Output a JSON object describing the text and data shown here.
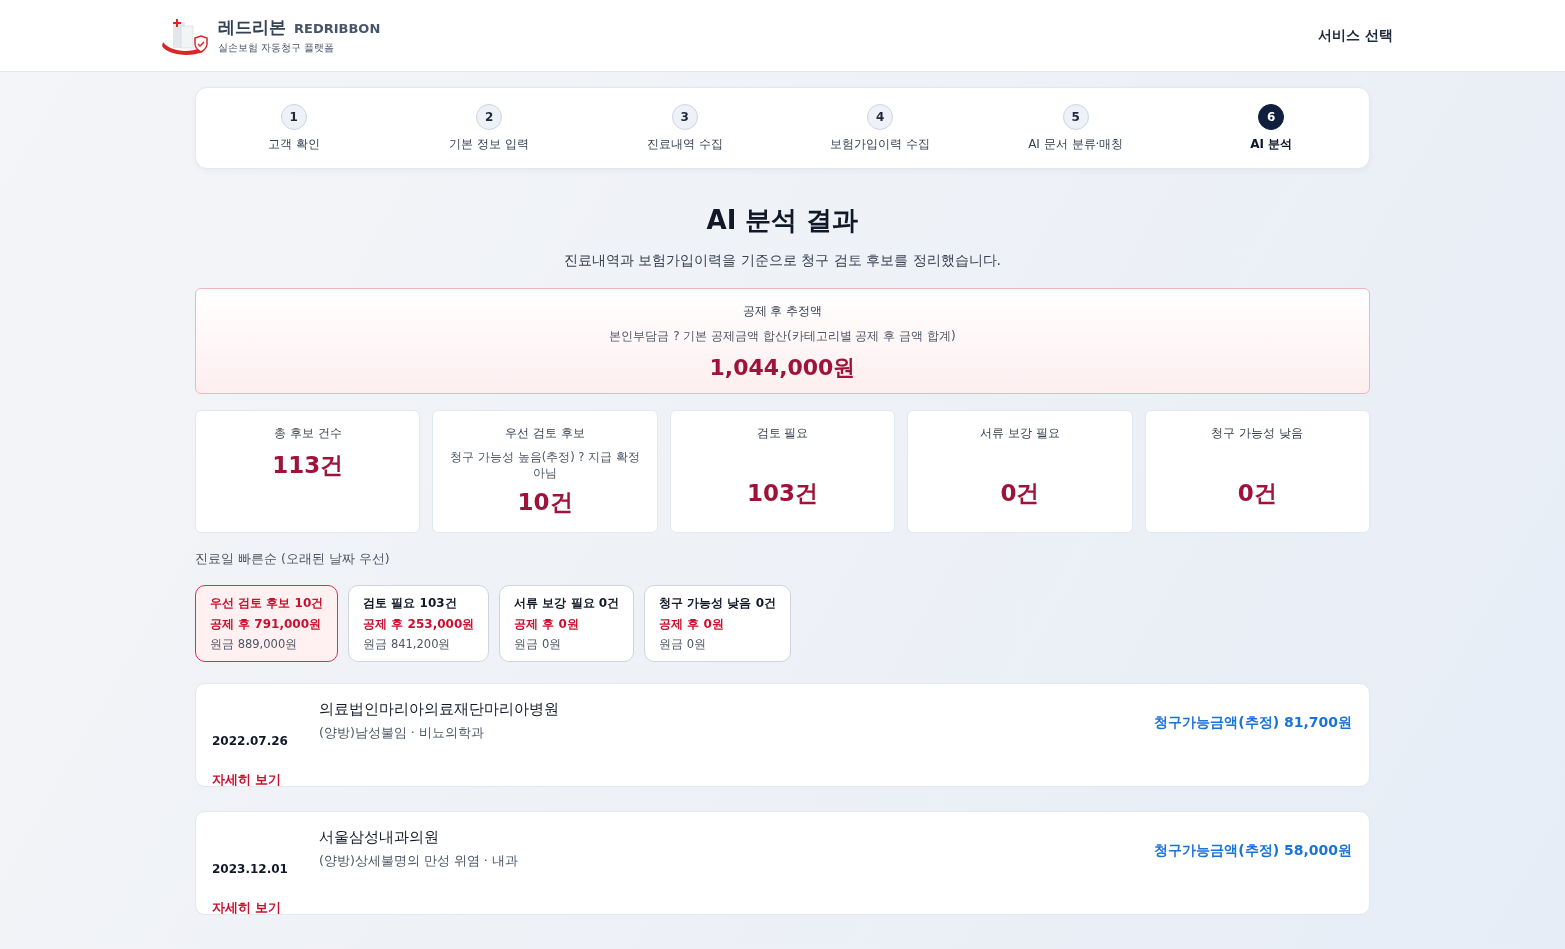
{
  "header": {
    "brand": "레드리본",
    "brand_en": "REDRIBBON",
    "tagline": "실손보험 자동청구 플랫폼",
    "menu": "서비스 선택"
  },
  "steps": [
    {
      "number": "1",
      "label": "고객 확인",
      "selected": false
    },
    {
      "number": "2",
      "label": "기본 정보 입력",
      "selected": false
    },
    {
      "number": "3",
      "label": "진료내역 수집",
      "selected": false
    },
    {
      "number": "4",
      "label": "보험가입이력 수집",
      "selected": false
    },
    {
      "number": "5",
      "label": "AI 문서 분류·매칭",
      "selected": false
    },
    {
      "number": "6",
      "label": "AI 분석",
      "selected": true
    }
  ],
  "title": "AI 분석 결과",
  "subtitle": "진료내역과 보험가입이력을 기준으로 청구 검토 후보를 정리했습니다.",
  "summary": {
    "label": "공제 후 추정액",
    "note": "본인부담금 ? 기본 공제금액 합산(카테고리별 공제 후 금액 합계)",
    "amount": "1,044,000원"
  },
  "stats": [
    {
      "kind": "compact",
      "label": "총 후보 건수",
      "value": "113건"
    },
    {
      "kind": "note",
      "label": "우선 검토 후보",
      "note": "청구 가능성 높음(추정) ? 지급 확정 아님",
      "value": "10건"
    },
    {
      "kind": "standard",
      "label": "검토 필요",
      "value": "103건"
    },
    {
      "kind": "standard",
      "label": "서류 보강 필요",
      "value": "0건"
    },
    {
      "kind": "standard",
      "label": "청구 가능성 낮음",
      "value": "0건"
    }
  ],
  "sort_label": "진료일 빠른순 (오래된 날짜 우선)",
  "filters": [
    {
      "title": "우선 검토 후보 10건",
      "after": "공제 후 791,000원",
      "original": "원금 889,000원",
      "selected": true
    },
    {
      "title": "검토 필요 103건",
      "after": "공제 후 253,000원",
      "original": "원금 841,200원",
      "selected": false
    },
    {
      "title": "서류 보강 필요 0건",
      "after": "공제 후 0원",
      "original": "원금 0원",
      "selected": false
    },
    {
      "title": "청구 가능성 낮음 0건",
      "after": "공제 후 0원",
      "original": "원금 0원",
      "selected": false
    }
  ],
  "records": [
    {
      "date": "2022.07.26",
      "hospital": "의료법인마리아의료재단마리아병원",
      "detail": "(양방)남성불임 · 비뇨의학과",
      "link": "자세히 보기",
      "amount": "청구가능금액(추정) 81,700원"
    },
    {
      "date": "2023.12.01",
      "hospital": "서울삼성내과의원",
      "detail": "(양방)상세불명의 만성 위염 · 내과",
      "link": "자세히 보기",
      "amount": "청구가능금액(추정) 58,000원"
    }
  ]
}
